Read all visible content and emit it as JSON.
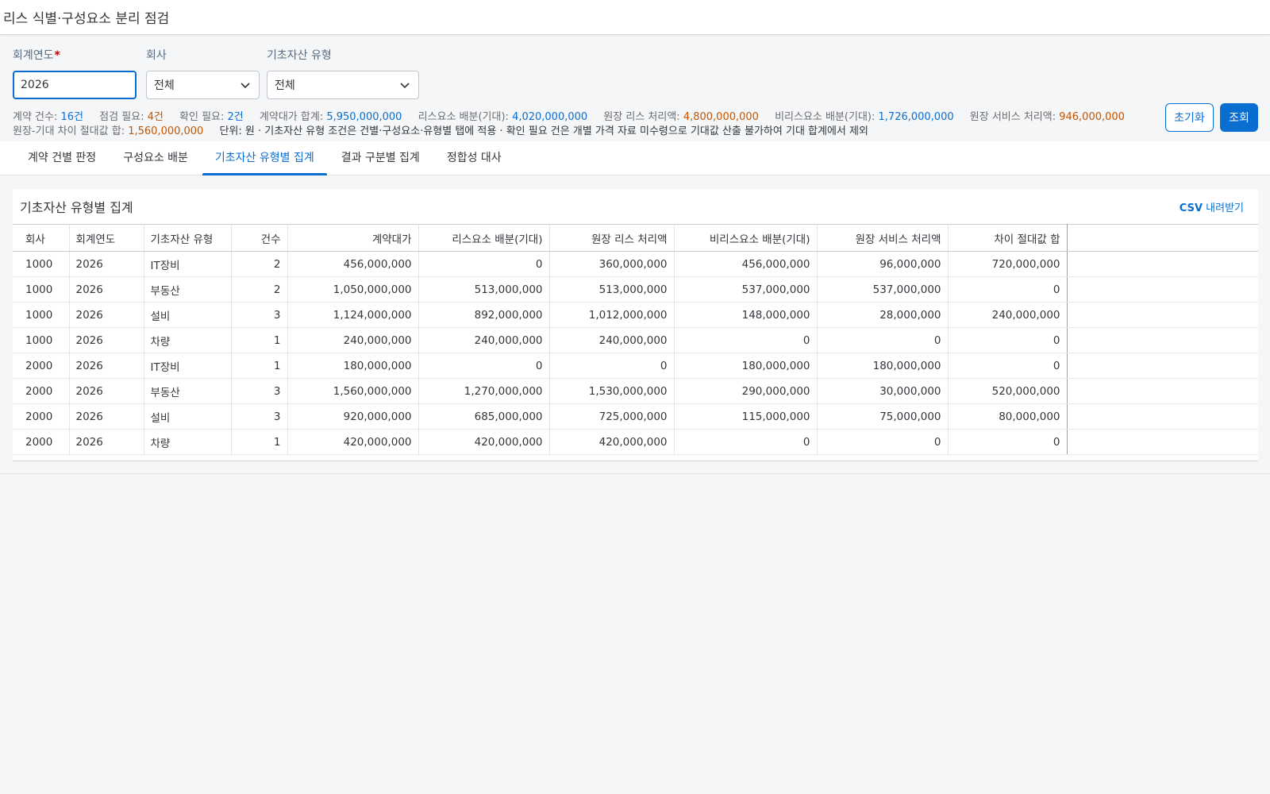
{
  "header": {
    "title": "리스 식별·구성요소 분리 점검"
  },
  "filters": {
    "fiscal_year": {
      "label": "회계연도",
      "required_mark": "*",
      "value": "2026"
    },
    "company": {
      "label": "회사",
      "value": "전체"
    },
    "asset_type": {
      "label": "기초자산 유형",
      "value": "전체"
    }
  },
  "buttons": {
    "reset": "초기화",
    "search": "조회"
  },
  "summary": {
    "contract_count": {
      "label": "계약 건수:",
      "value": "16건"
    },
    "check_required": {
      "label": "점검 필요:",
      "value": "4건"
    },
    "confirm_required": {
      "label": "확인 필요:",
      "value": "2건"
    },
    "contract_total": {
      "label": "계약대가 합계:",
      "value": "5,950,000,000"
    },
    "lease_alloc": {
      "label": "리스요소 배분(기대):",
      "value": "4,020,000,000"
    },
    "ledger_lease": {
      "label": "원장 리스 처리액:",
      "value": "4,800,000,000"
    },
    "nonlease_alloc": {
      "label": "비리스요소 배분(기대):",
      "value": "1,726,000,000"
    },
    "ledger_service": {
      "label": "원장 서비스 처리액:",
      "value": "946,000,000"
    },
    "diff_abs": {
      "label": "원장-기대 차이 절대값 합:",
      "value": "1,560,000,000"
    },
    "note": "단위: 원 · 기초자산 유형 조건은 건별·구성요소·유형별 탭에 적용 · 확인 필요 건은 개별 가격 자료 미수령으로 기대값 산출 불가하여 기대 합계에서 제외"
  },
  "tabs": [
    {
      "label": "계약 건별 판정",
      "active": false
    },
    {
      "label": "구성요소 배분",
      "active": false
    },
    {
      "label": "기초자산 유형별 집계",
      "active": true
    },
    {
      "label": "결과 구분별 집계",
      "active": false
    },
    {
      "label": "정합성 대사",
      "active": false
    }
  ],
  "panel": {
    "title": "기초자산 유형별 집계",
    "csv_bold": "CSV",
    "csv_rest": " 내려받기"
  },
  "table": {
    "columns": [
      "회사",
      "회계연도",
      "기초자산 유형",
      "건수",
      "계약대가",
      "리스요소 배분(기대)",
      "원장 리스 처리액",
      "비리스요소 배분(기대)",
      "원장 서비스 처리액",
      "차이 절대값 합"
    ],
    "rows": [
      [
        "1000",
        "2026",
        "IT장비",
        "2",
        "456,000,000",
        "0",
        "360,000,000",
        "456,000,000",
        "96,000,000",
        "720,000,000"
      ],
      [
        "1000",
        "2026",
        "부동산",
        "2",
        "1,050,000,000",
        "513,000,000",
        "513,000,000",
        "537,000,000",
        "537,000,000",
        "0"
      ],
      [
        "1000",
        "2026",
        "설비",
        "3",
        "1,124,000,000",
        "892,000,000",
        "1,012,000,000",
        "148,000,000",
        "28,000,000",
        "240,000,000"
      ],
      [
        "1000",
        "2026",
        "차량",
        "1",
        "240,000,000",
        "240,000,000",
        "240,000,000",
        "0",
        "0",
        "0"
      ],
      [
        "2000",
        "2026",
        "IT장비",
        "1",
        "180,000,000",
        "0",
        "0",
        "180,000,000",
        "180,000,000",
        "0"
      ],
      [
        "2000",
        "2026",
        "부동산",
        "3",
        "1,560,000,000",
        "1,270,000,000",
        "1,530,000,000",
        "290,000,000",
        "30,000,000",
        "520,000,000"
      ],
      [
        "2000",
        "2026",
        "설비",
        "3",
        "920,000,000",
        "685,000,000",
        "725,000,000",
        "115,000,000",
        "75,000,000",
        "80,000,000"
      ],
      [
        "2000",
        "2026",
        "차량",
        "1",
        "420,000,000",
        "420,000,000",
        "420,000,000",
        "0",
        "0",
        "0"
      ]
    ]
  },
  "colors": {
    "accent": "#0a6ed1",
    "warning": "#c35500",
    "required": "#bb0000"
  }
}
